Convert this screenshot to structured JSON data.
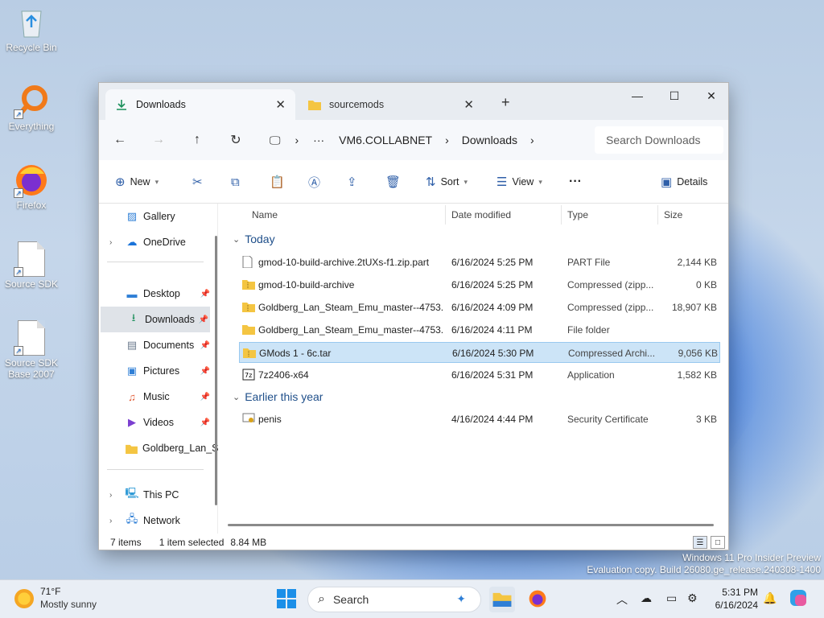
{
  "desktop": {
    "icons": [
      {
        "label": "Recycle Bin",
        "icon": "recycle-bin-icon"
      },
      {
        "label": "Everything",
        "icon": "everything-search-icon"
      },
      {
        "label": "Firefox",
        "icon": "firefox-icon"
      },
      {
        "label": "Source SDK",
        "icon": "document-icon"
      },
      {
        "label": "Source SDK Base 2007",
        "icon": "document-icon"
      }
    ],
    "watermark_line1": "Windows 11 Pro Insider Preview",
    "watermark_line2": "Evaluation copy. Build 26080.ge_release.240308-1400"
  },
  "explorer": {
    "tabs": [
      {
        "label": "Downloads",
        "icon": "download-icon",
        "active": true
      },
      {
        "label": "sourcemods",
        "icon": "folder-icon",
        "active": false
      }
    ],
    "window_controls": {
      "minimize": "—",
      "maximize": "☐",
      "close": "✕"
    },
    "breadcrumb": {
      "overflow": "···",
      "items": [
        "VM6.COLLABNET",
        "Downloads"
      ]
    },
    "search_placeholder": "Search Downloads",
    "toolbar": {
      "new_label": "New",
      "sort_label": "Sort",
      "view_label": "View",
      "more_label": "···",
      "details_label": "Details"
    },
    "nav": {
      "top": [
        {
          "label": "Gallery",
          "icon": "gallery-icon"
        },
        {
          "label": "OneDrive",
          "icon": "onedrive-icon"
        }
      ],
      "quick_access": [
        {
          "label": "Desktop",
          "icon": "desktop-icon",
          "pinned": true
        },
        {
          "label": "Downloads",
          "icon": "download-icon",
          "pinned": true,
          "selected": true
        },
        {
          "label": "Documents",
          "icon": "documents-icon",
          "pinned": true
        },
        {
          "label": "Pictures",
          "icon": "pictures-icon",
          "pinned": true
        },
        {
          "label": "Music",
          "icon": "music-icon",
          "pinned": true
        },
        {
          "label": "Videos",
          "icon": "videos-icon",
          "pinned": true
        },
        {
          "label": "Goldberg_Lan_S",
          "icon": "folder-icon",
          "pinned": false
        }
      ],
      "bottom": [
        {
          "label": "This PC",
          "icon": "pc-icon"
        },
        {
          "label": "Network",
          "icon": "network-icon"
        }
      ]
    },
    "columns": [
      "Name",
      "Date modified",
      "Type",
      "Size"
    ],
    "groups": [
      {
        "label": "Today",
        "rows": [
          {
            "name": "gmod-10-build-archive.2tUXs-f1.zip.part",
            "date": "6/16/2024 5:25 PM",
            "type": "PART File",
            "size": "2,144 KB",
            "icon": "file-icon"
          },
          {
            "name": "gmod-10-build-archive",
            "date": "6/16/2024 5:25 PM",
            "type": "Compressed (zipp...",
            "size": "0 KB",
            "icon": "zip-folder-icon"
          },
          {
            "name": "Goldberg_Lan_Steam_Emu_master--4753...",
            "date": "6/16/2024 4:09 PM",
            "type": "Compressed (zipp...",
            "size": "18,907 KB",
            "icon": "zip-folder-icon"
          },
          {
            "name": "Goldberg_Lan_Steam_Emu_master--4753...",
            "date": "6/16/2024 4:11 PM",
            "type": "File folder",
            "size": "",
            "icon": "folder-icon"
          },
          {
            "name": "GMods 1 - 6c.tar",
            "date": "6/16/2024 5:30 PM",
            "type": "Compressed Archi...",
            "size": "9,056 KB",
            "icon": "archive-icon",
            "selected": true
          },
          {
            "name": "7z2406-x64",
            "date": "6/16/2024 5:31 PM",
            "type": "Application",
            "size": "1,582 KB",
            "icon": "7zip-icon"
          }
        ]
      },
      {
        "label": "Earlier this year",
        "rows": [
          {
            "name": "penis",
            "date": "4/16/2024 4:44 PM",
            "type": "Security Certificate",
            "size": "3 KB",
            "icon": "certificate-icon"
          }
        ]
      }
    ],
    "status": {
      "count": "7 items",
      "selection": "1 item selected",
      "size": "8.84 MB"
    }
  },
  "taskbar": {
    "weather_temp": "71°F",
    "weather_desc": "Mostly sunny",
    "search_label": "Search",
    "time": "5:31 PM",
    "date": "6/16/2024"
  }
}
